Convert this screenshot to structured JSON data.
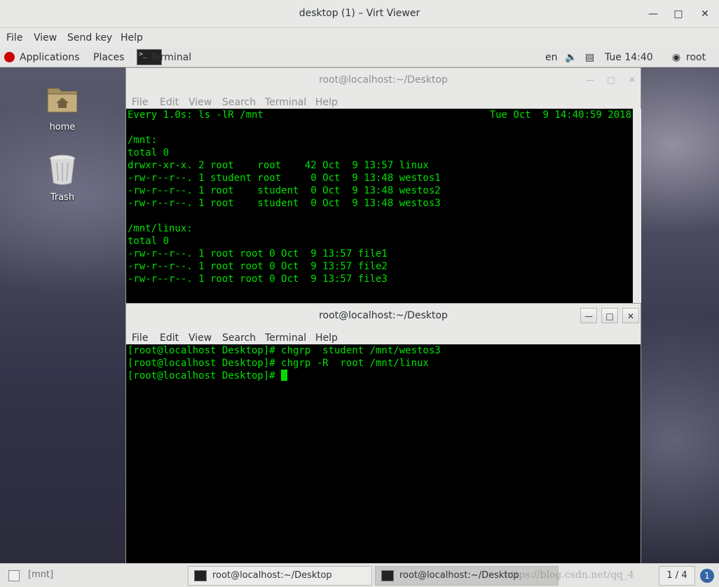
{
  "viewer": {
    "title": "desktop (1) – Virt Viewer",
    "menu": [
      "File",
      "View",
      "Send key",
      "Help"
    ]
  },
  "topbar": {
    "applications": "Applications",
    "places": "Places",
    "active_app": "Terminal",
    "lang": "en",
    "clock": "Tue 14:40",
    "user": "root"
  },
  "desktop_icons": [
    {
      "label": "home"
    },
    {
      "label": "Trash"
    }
  ],
  "term_back": {
    "title": "root@localhost:~/Desktop",
    "menu": [
      "File",
      "Edit",
      "View",
      "Search",
      "Terminal",
      "Help"
    ],
    "header_left": "Every 1.0s: ls -lR /mnt",
    "header_right": "Tue Oct  9 14:40:59 2018",
    "lines": [
      "",
      "/mnt:",
      "total 0",
      "drwxr-xr-x. 2 root    root    42 Oct  9 13:57 linux",
      "-rw-r--r--. 1 student root     0 Oct  9 13:48 westos1",
      "-rw-r--r--. 1 root    student  0 Oct  9 13:48 westos2",
      "-rw-r--r--. 1 root    student  0 Oct  9 13:48 westos3",
      "",
      "/mnt/linux:",
      "total 0",
      "-rw-r--r--. 1 root root 0 Oct  9 13:57 file1",
      "-rw-r--r--. 1 root root 0 Oct  9 13:57 file2",
      "-rw-r--r--. 1 root root 0 Oct  9 13:57 file3"
    ]
  },
  "term_front": {
    "title": "root@localhost:~/Desktop",
    "menu": [
      "File",
      "Edit",
      "View",
      "Search",
      "Terminal",
      "Help"
    ],
    "lines": [
      "[root@localhost Desktop]# chgrp  student /mnt/westos3",
      "[root@localhost Desktop]# chgrp -R  root /mnt/linux"
    ],
    "prompt": "[root@localhost Desktop]# "
  },
  "taskbar": {
    "items": [
      "[mnt]",
      "root@localhost:~/Desktop",
      "root@localhost:~/Desktop"
    ],
    "watermark": "https://blog.csdn.net/qq_4",
    "pager": "1 / 4"
  },
  "colors": {
    "terminal_bg": "#000000",
    "terminal_fg": "#00e000"
  }
}
